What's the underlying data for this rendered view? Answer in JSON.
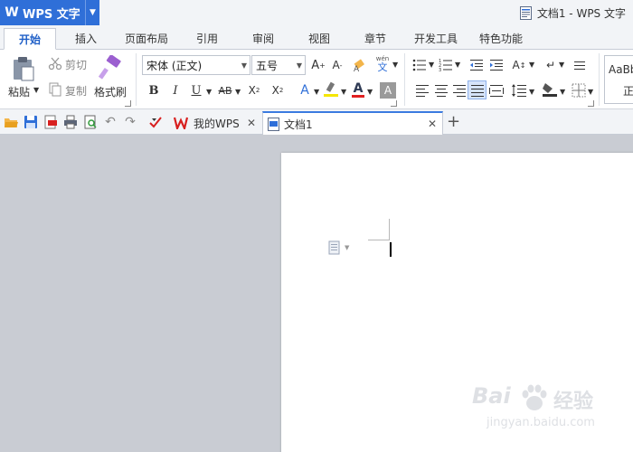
{
  "app": {
    "name": "WPS 文字",
    "document_title": "文档1 - WPS 文字"
  },
  "ribbon_tabs": [
    {
      "label": "开始",
      "active": true
    },
    {
      "label": "插入"
    },
    {
      "label": "页面布局"
    },
    {
      "label": "引用"
    },
    {
      "label": "审阅"
    },
    {
      "label": "视图"
    },
    {
      "label": "章节"
    },
    {
      "label": "开发工具"
    },
    {
      "label": "特色功能"
    }
  ],
  "clipboard": {
    "paste": "粘贴",
    "cut": "剪切",
    "copy": "复制",
    "format_painter": "格式刷"
  },
  "font": {
    "name": "宋体 (正文)",
    "size": "五号",
    "wen_label": "文",
    "wen_top": "wén",
    "color_letter": "A"
  },
  "styles": {
    "preview": "AaBb",
    "name": "正"
  },
  "doc_tabs": [
    {
      "label": "我的WPS"
    },
    {
      "label": "文档1",
      "active": true
    }
  ],
  "colors": {
    "accent": "#2f6fd8",
    "tab_active_text": "#1f5fc7",
    "font_color": "#e02020",
    "highlight": "#f5e600",
    "wps_red": "#d82020"
  },
  "watermark": {
    "brand": "Bai",
    "brand_suffix": "经验",
    "url": "jingyan.baidu.com"
  }
}
